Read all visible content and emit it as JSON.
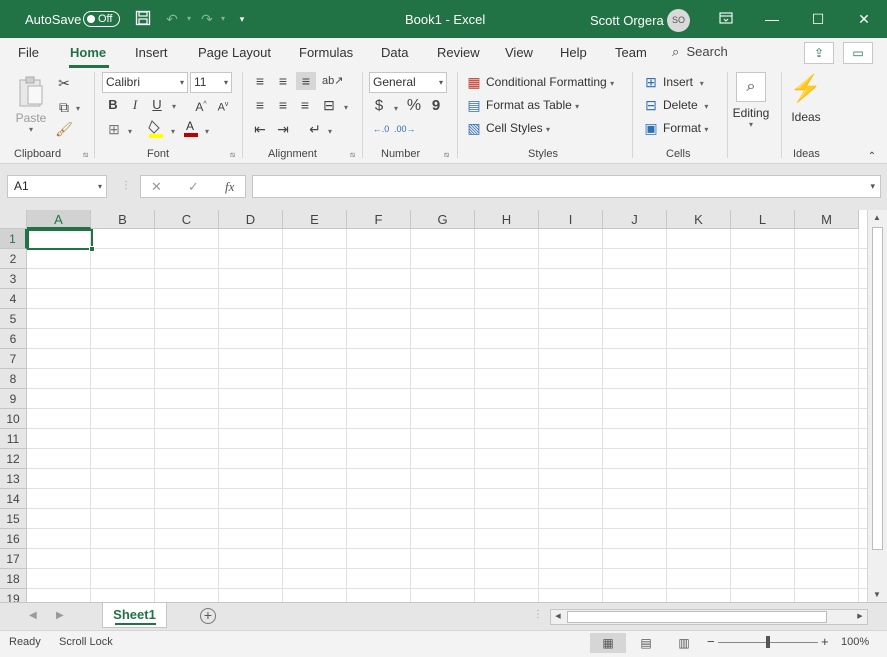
{
  "titlebar": {
    "autosave_label": "AutoSave",
    "autosave_state": "Off",
    "doc_title": "Book1  -  Excel",
    "user_name": "Scott Orgera",
    "user_initials": "SO",
    "bg_color": "#217346",
    "icons": [
      "save-icon",
      "undo-icon",
      "redo-icon",
      "customize-qat-icon",
      "ribbon-display-icon",
      "minimize-icon",
      "maximize-icon",
      "close-icon"
    ]
  },
  "tabs": {
    "items": [
      "File",
      "Home",
      "Insert",
      "Page Layout",
      "Formulas",
      "Data",
      "Review",
      "View",
      "Help",
      "Team"
    ],
    "active": "Home",
    "search_label": "Search"
  },
  "ribbon": {
    "clipboard": {
      "label": "Clipboard",
      "paste": "Paste"
    },
    "font": {
      "label": "Font",
      "name": "Calibri",
      "size": "11",
      "bold": "B",
      "italic": "I",
      "underline": "U"
    },
    "alignment": {
      "label": "Alignment"
    },
    "number": {
      "label": "Number",
      "format": "General",
      "currency": "$",
      "percent": "%",
      "comma": "9"
    },
    "styles": {
      "label": "Styles",
      "conditional": "Conditional Formatting",
      "format_table": "Format as Table",
      "cell_styles": "Cell Styles"
    },
    "cells": {
      "label": "Cells",
      "insert": "Insert",
      "delete": "Delete",
      "format": "Format"
    },
    "editing": {
      "label": "Editing"
    },
    "ideas": {
      "label": "Ideas",
      "button": "Ideas"
    }
  },
  "formula_bar": {
    "name_box": "A1",
    "fx": "fx",
    "cancel": "✕",
    "enter": "✓",
    "formula": ""
  },
  "grid": {
    "columns": [
      "A",
      "B",
      "C",
      "D",
      "E",
      "F",
      "G",
      "H",
      "I",
      "J",
      "K",
      "L",
      "M"
    ],
    "rows": [
      "1",
      "2",
      "3",
      "4",
      "5",
      "6",
      "7",
      "8",
      "9",
      "10",
      "11",
      "12",
      "13",
      "14",
      "15",
      "16",
      "17",
      "18",
      "19"
    ],
    "active_cell": "A1"
  },
  "sheets": {
    "tabs": [
      "Sheet1"
    ],
    "active": "Sheet1",
    "add_label": "+"
  },
  "status": {
    "ready": "Ready",
    "scroll_lock": "Scroll Lock",
    "zoom": "100%",
    "zoom_minus": "−",
    "zoom_plus": "+"
  }
}
